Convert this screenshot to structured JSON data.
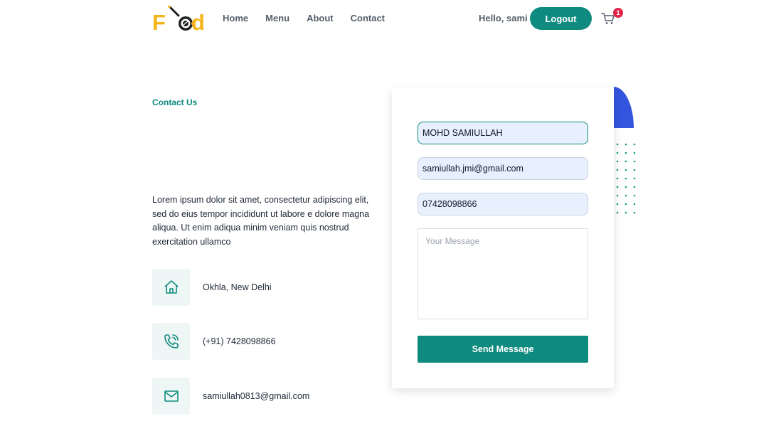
{
  "header": {
    "logo": {
      "text_start": "F",
      "text_end": "d"
    },
    "nav": [
      {
        "label": "Home"
      },
      {
        "label": "Menu"
      },
      {
        "label": "About"
      },
      {
        "label": "Contact"
      }
    ],
    "greeting": "Hello, sami",
    "logout_label": "Logout",
    "cart": {
      "icon": "cart-icon",
      "badge_count": "1"
    }
  },
  "contact": {
    "section_title": "Contact Us",
    "description": "Lorem ipsum dolor sit amet, consectetur adipiscing elit, sed do eius tempor incididunt ut labore e dolore magna aliqua. Ut enim adiqua minim veniam quis nostrud exercitation ullamco",
    "info": [
      {
        "icon": "home-icon",
        "text": "Okhla, New Delhi"
      },
      {
        "icon": "phone-icon",
        "text": "(+91) 7428098866"
      },
      {
        "icon": "mail-icon",
        "text": "samiullah0813@gmail.com"
      }
    ]
  },
  "form": {
    "name_value": "MOHD SAMIULLAH",
    "email_value": "samiullah.jmi@gmail.com",
    "phone_value": "07428098866",
    "message_placeholder": "Your Message",
    "send_label": "Send Message"
  },
  "colors": {
    "accent": "#0f8a7e",
    "logo": "#f4b41a",
    "badge": "#e0244a",
    "decoration": "#3355dd"
  }
}
